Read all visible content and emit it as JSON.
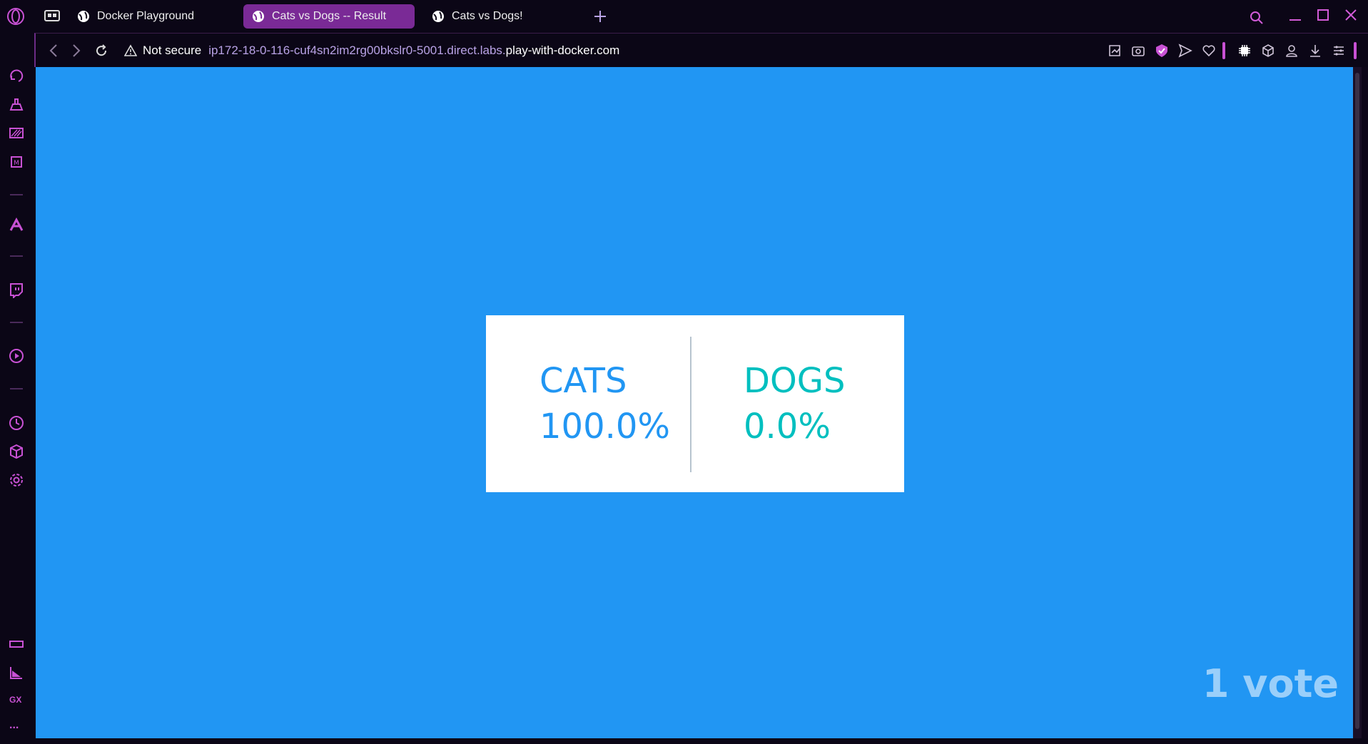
{
  "tabs": [
    {
      "label": "Docker Playground"
    },
    {
      "label": "Cats vs Dogs -- Result"
    },
    {
      "label": "Cats vs Dogs!"
    }
  ],
  "address": {
    "security_label": "Not secure",
    "url_host_part": "ip172-18-0-116-cuf4sn2im2rg00bkslr0-5001.direct.labs.",
    "url_domain": "play-with-docker.com"
  },
  "result": {
    "cats_label": "CATS",
    "cats_percent": "100.0%",
    "dogs_label": "DOGS",
    "dogs_percent": "0.0%",
    "votes": "1 vote"
  },
  "sidebar": {
    "gx_label": "GX",
    "more_label": "..."
  },
  "colors": {
    "background": "#2196f3",
    "cats": "#2196f3",
    "dogs": "#00bfbf",
    "accent": "#c851d4"
  }
}
